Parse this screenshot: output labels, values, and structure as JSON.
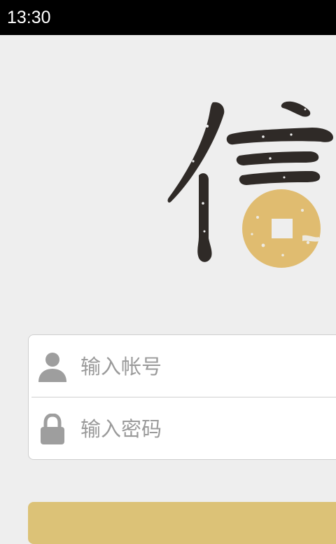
{
  "status_bar": {
    "time": "13:30"
  },
  "logo": {
    "icon": "xin-character-coin-logo",
    "ink_color": "#2f2a27",
    "coin_color": "#e0bc70"
  },
  "login_form": {
    "account_placeholder": "输入帐号",
    "password_placeholder": "输入密码",
    "account_icon": "user-icon",
    "password_icon": "lock-icon",
    "icon_color": "#9e9e9e"
  },
  "login_button": {
    "color": "#dcc277"
  }
}
